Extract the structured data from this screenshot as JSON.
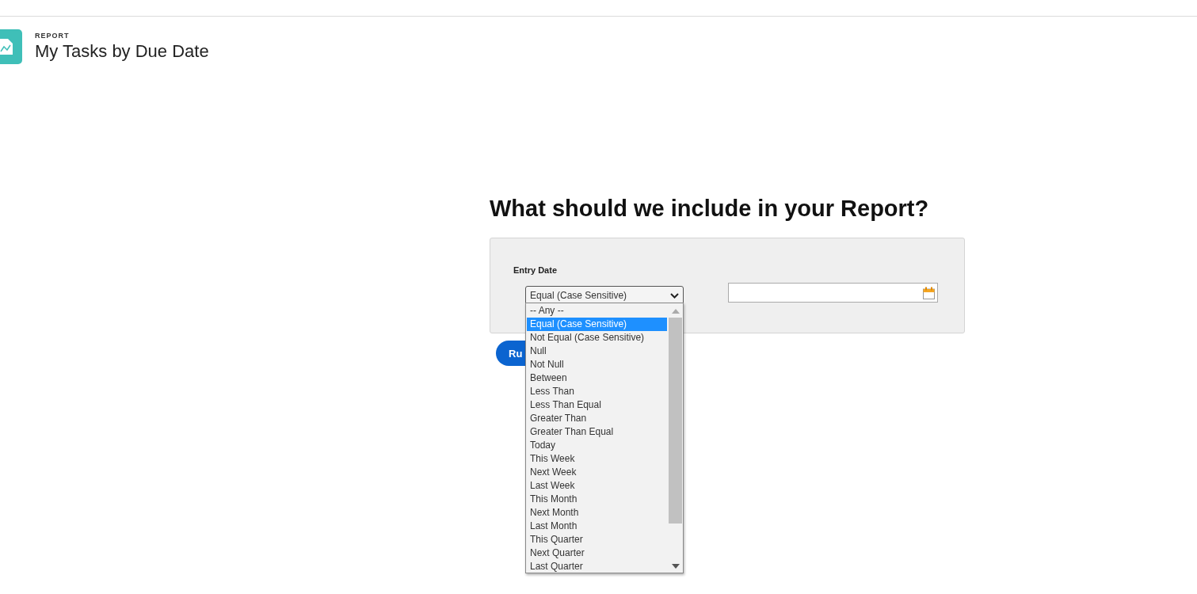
{
  "header": {
    "type_label": "REPORT",
    "title": "My Tasks by Due Date"
  },
  "prompt": {
    "heading": "What should we include in your Report?"
  },
  "filter": {
    "label": "Entry Date",
    "operator": "Equal (Case Sensitive)",
    "options": [
      {
        "label": "-- Any --",
        "selected": false
      },
      {
        "label": "Equal (Case Sensitive)",
        "selected": true
      },
      {
        "label": "Not Equal (Case Sensitive)",
        "selected": false
      },
      {
        "label": "Null",
        "selected": false
      },
      {
        "label": "Not Null",
        "selected": false
      },
      {
        "label": "Between",
        "selected": false
      },
      {
        "label": "Less Than",
        "selected": false
      },
      {
        "label": "Less Than Equal",
        "selected": false
      },
      {
        "label": "Greater Than",
        "selected": false
      },
      {
        "label": "Greater Than Equal",
        "selected": false
      },
      {
        "label": "Today",
        "selected": false
      },
      {
        "label": "This Week",
        "selected": false
      },
      {
        "label": "Next Week",
        "selected": false
      },
      {
        "label": "Last Week",
        "selected": false
      },
      {
        "label": "This Month",
        "selected": false
      },
      {
        "label": "Next Month",
        "selected": false
      },
      {
        "label": "Last Month",
        "selected": false
      },
      {
        "label": "This Quarter",
        "selected": false
      },
      {
        "label": "Next Quarter",
        "selected": false
      },
      {
        "label": "Last Quarter",
        "selected": false
      }
    ]
  },
  "run_button": {
    "label": "Ru"
  }
}
